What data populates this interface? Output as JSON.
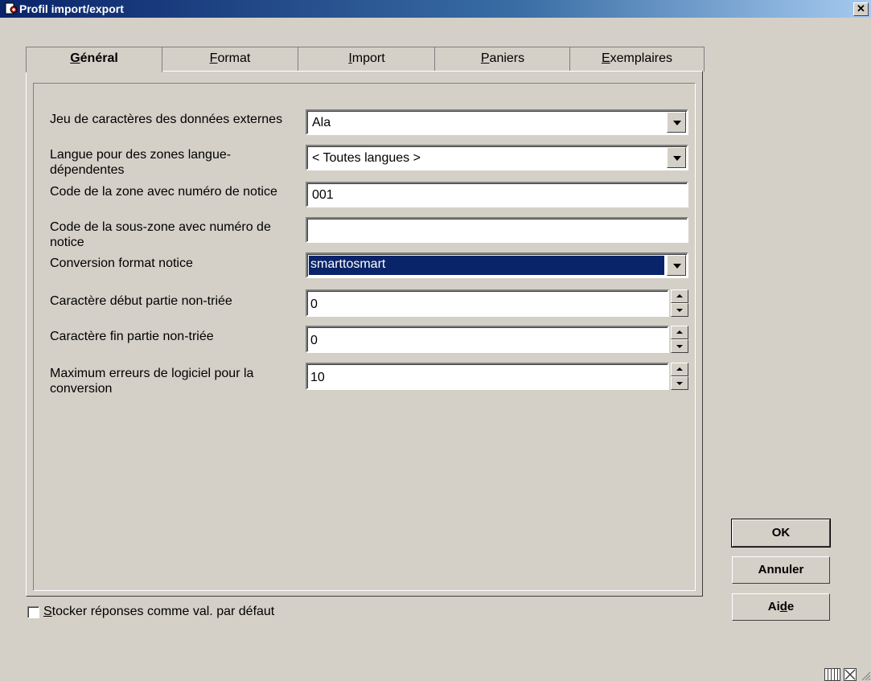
{
  "window": {
    "title": "Profil import/export",
    "close_symbol": "✕"
  },
  "tabs": [
    {
      "label_pre": "",
      "label_u": "G",
      "label_post": "énéral",
      "active": true
    },
    {
      "label_pre": "",
      "label_u": "F",
      "label_post": "ormat",
      "active": false
    },
    {
      "label_pre": "",
      "label_u": "I",
      "label_post": "mport",
      "active": false
    },
    {
      "label_pre": "",
      "label_u": "P",
      "label_post": "aniers",
      "active": false
    },
    {
      "label_pre": "",
      "label_u": "E",
      "label_post": "xemplaires",
      "active": false
    }
  ],
  "form": {
    "charset": {
      "label": "Jeu de caractères des données externes",
      "value": "Ala"
    },
    "language": {
      "label": "Langue pour des zones langue-dépendentes",
      "value": "< Toutes langues >"
    },
    "record_zone": {
      "label": "Code de la zone avec numéro de notice",
      "value": "001"
    },
    "record_subzone": {
      "label": "Code de la sous-zone avec numéro de notice",
      "value": ""
    },
    "conversion": {
      "label": "Conversion format notice",
      "value": "smarttosmart"
    },
    "unsorted_start": {
      "label": "Caractère début partie non-triée",
      "value": "0"
    },
    "unsorted_end": {
      "label": "Caractère fin partie non-triée",
      "value": "0"
    },
    "max_errors": {
      "label": "Maximum erreurs de logiciel pour la conversion",
      "value": "10"
    }
  },
  "buttons": {
    "ok": "OK",
    "cancel": "Annuler",
    "help_pre": "Ai",
    "help_u": "d",
    "help_post": "e"
  },
  "store_defaults": {
    "label_u": "S",
    "label_rest": "tocker réponses comme val. par défaut",
    "checked": false
  },
  "colors": {
    "face": "#d4d0c8",
    "title_start": "#0a246a",
    "title_end": "#a6caf0",
    "selection": "#0a246a"
  }
}
